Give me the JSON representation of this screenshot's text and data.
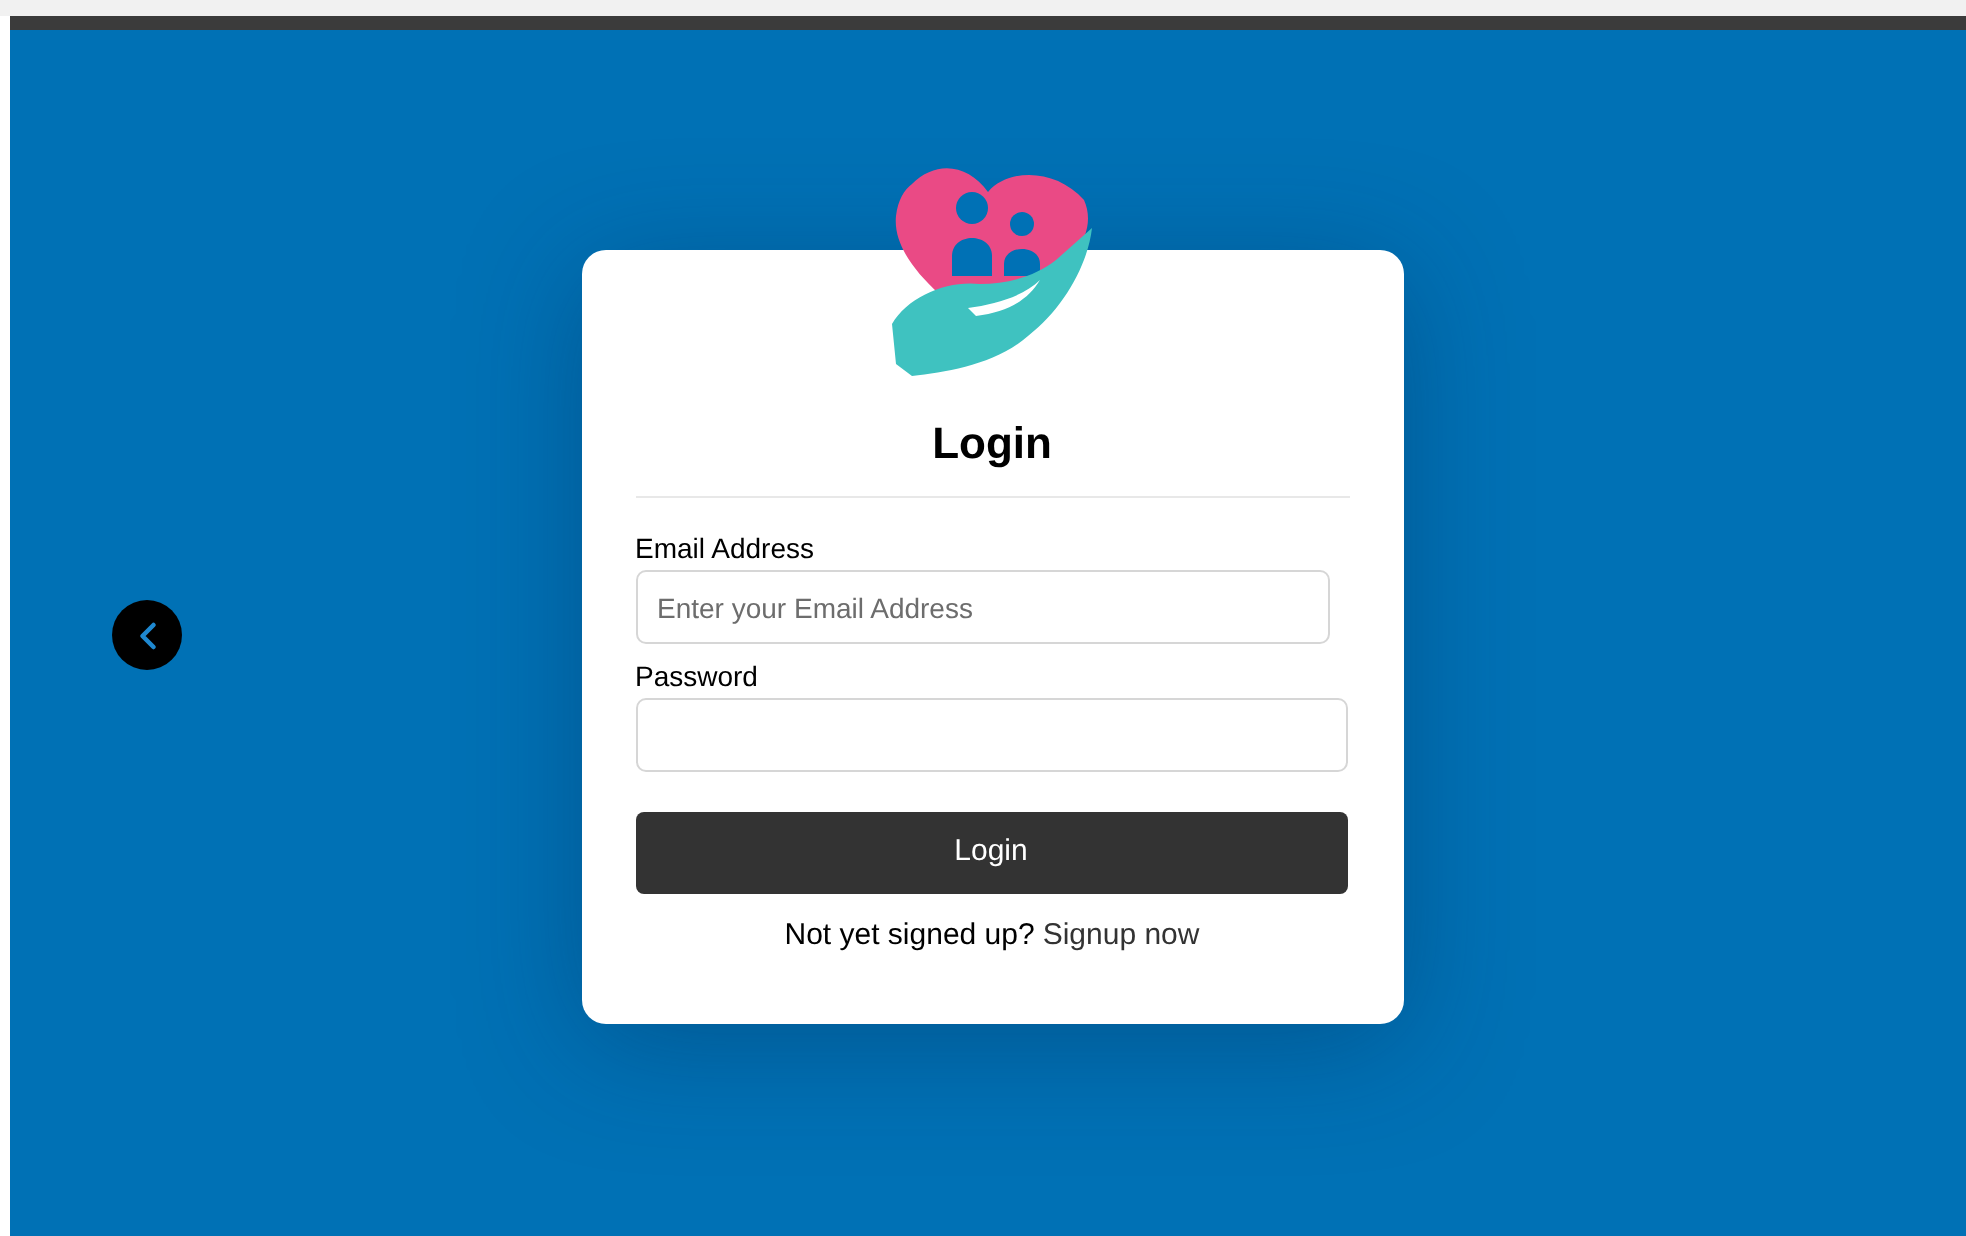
{
  "card": {
    "title": "Login",
    "fields": [
      {
        "label": "Email Address",
        "placeholder": "Enter your Email Address",
        "kind": "email"
      },
      {
        "label": "Password",
        "kind": "password"
      }
    ],
    "submit": "Login",
    "prompt": "Not yet signed up?",
    "link": "Signup now"
  }
}
